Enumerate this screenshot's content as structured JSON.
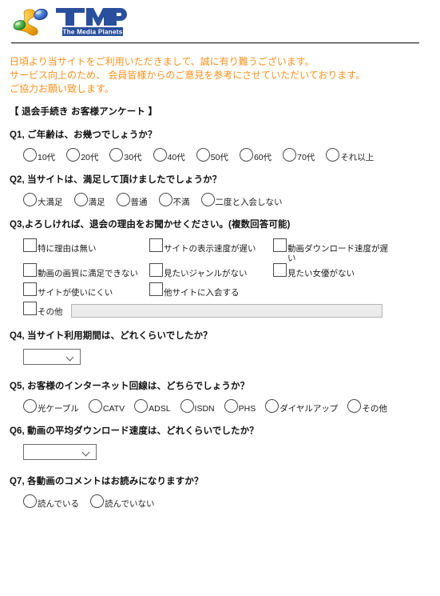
{
  "brand": {
    "logo_icon": "tmp-planets-logo-icon",
    "wordmark": "TMP",
    "tagline": "The Media Planets",
    "colors": {
      "wordmark_blue": "#2a4f9c",
      "orb_orange": "#f0a81e",
      "orb_blue": "#3a6fd0",
      "orb_green": "#3fae46",
      "intro_orange": "#f6921e"
    }
  },
  "intro": {
    "line1": "日頃より当サイトをご利用いただきまして、誠に有り難うございます。",
    "line2": "サービス向上のため、 会員皆様からのご意見を参考にさせていただいております。",
    "line3": "ご協力お願い致します。"
  },
  "form": {
    "title": "【 退会手続き お客様アンケート 】",
    "questions": [
      {
        "id": "q1",
        "label": "Q1, ご年齢は、お幾つでしょうか？",
        "type": "radio",
        "options": [
          "10代",
          "20代",
          "30代",
          "40代",
          "50代",
          "60代",
          "70代",
          "それ以上"
        ]
      },
      {
        "id": "q2",
        "label": "Q2, 当サイトは、満足して頂けましたでしょうか？",
        "type": "radio",
        "options": [
          "大満足",
          "満足",
          "普通",
          "不満",
          "二度と入会しない"
        ]
      },
      {
        "id": "q3",
        "label": "Q3,よろしければ、退会の理由をお聞かせください。(複数回答可能)",
        "type": "checkbox",
        "options": [
          "特に理由は無い",
          "サイトの表示速度が遅い",
          "動画ダウンロード速度が遅い",
          "動画の画質に満足できない",
          "見たいジャンルがない",
          "見たい女優がない",
          "サイトが使いにくい",
          "他サイトに入会する"
        ],
        "other_label": "その他",
        "other_value": "",
        "other_placeholder": ""
      },
      {
        "id": "q4",
        "label": "Q4, 当サイト利用期間は、どれくらいでしたか？",
        "type": "select",
        "selected": ""
      },
      {
        "id": "q5",
        "label": "Q5, お客様のインターネット回線は、どちらでしょうか？",
        "type": "radio",
        "options": [
          "光ケーブル",
          "CATV",
          "ADSL",
          "ISDN",
          "PHS",
          "ダイヤルアップ",
          "その他"
        ]
      },
      {
        "id": "q6",
        "label": "Q6, 動画の平均ダウンロード速度は、どれくらいでしたか？",
        "type": "select",
        "selected": ""
      },
      {
        "id": "q7",
        "label": "Q7, 各動画のコメントはお読みになりますか？",
        "type": "radio",
        "options": [
          "読んでいる",
          "読んでいない"
        ]
      }
    ]
  }
}
